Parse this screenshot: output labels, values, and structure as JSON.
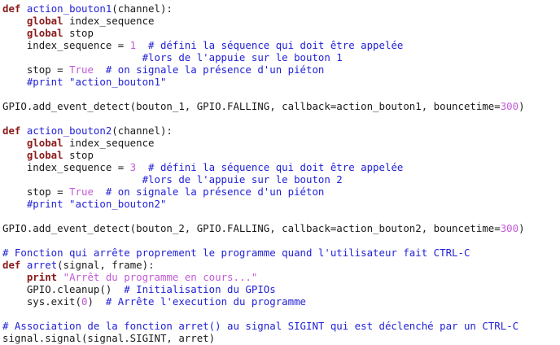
{
  "editor": {
    "theme": {
      "keyword": "#8b1a1a",
      "function_name": "#1f1fd6",
      "number": "#c25bd6",
      "string": "#c25bd6",
      "comment": "#1f1fd6",
      "text": "#1a1a1a",
      "background": "#ffffff"
    },
    "lines": [
      [
        {
          "t": "def",
          "c": "kw"
        },
        {
          "t": " ",
          "c": "pl"
        },
        {
          "t": "action_bouton1",
          "c": "fn"
        },
        {
          "t": "(channel):",
          "c": "pl"
        }
      ],
      [
        {
          "t": "    ",
          "c": "pl"
        },
        {
          "t": "global",
          "c": "kw"
        },
        {
          "t": " index_sequence",
          "c": "pl"
        }
      ],
      [
        {
          "t": "    ",
          "c": "pl"
        },
        {
          "t": "global",
          "c": "kw"
        },
        {
          "t": " stop",
          "c": "pl"
        }
      ],
      [
        {
          "t": "    index_sequence = ",
          "c": "pl"
        },
        {
          "t": "1",
          "c": "num"
        },
        {
          "t": "  ",
          "c": "pl"
        },
        {
          "t": "# défini la séquence qui doit être appelée",
          "c": "com"
        }
      ],
      [
        {
          "t": "                       ",
          "c": "pl"
        },
        {
          "t": "#lors de l'appuie sur le bouton 1",
          "c": "com"
        }
      ],
      [
        {
          "t": "    stop = ",
          "c": "pl"
        },
        {
          "t": "True",
          "c": "num"
        },
        {
          "t": "  ",
          "c": "pl"
        },
        {
          "t": "# on signale la présence d'un piéton",
          "c": "com"
        }
      ],
      [
        {
          "t": "    ",
          "c": "pl"
        },
        {
          "t": "#print \"action_bouton1\"",
          "c": "com"
        }
      ],
      [
        {
          "t": "",
          "c": "pl"
        }
      ],
      [
        {
          "t": "GPIO.add_event_detect(bouton_1, GPIO.FALLING, callback=action_bouton1, bouncetime=",
          "c": "pl"
        },
        {
          "t": "300",
          "c": "num"
        },
        {
          "t": ")",
          "c": "pl"
        }
      ],
      [
        {
          "t": "",
          "c": "pl"
        }
      ],
      [
        {
          "t": "def",
          "c": "kw"
        },
        {
          "t": " ",
          "c": "pl"
        },
        {
          "t": "action_bouton2",
          "c": "fn"
        },
        {
          "t": "(channel):",
          "c": "pl"
        }
      ],
      [
        {
          "t": "    ",
          "c": "pl"
        },
        {
          "t": "global",
          "c": "kw"
        },
        {
          "t": " index_sequence",
          "c": "pl"
        }
      ],
      [
        {
          "t": "    ",
          "c": "pl"
        },
        {
          "t": "global",
          "c": "kw"
        },
        {
          "t": " stop",
          "c": "pl"
        }
      ],
      [
        {
          "t": "    index_sequence = ",
          "c": "pl"
        },
        {
          "t": "3",
          "c": "num"
        },
        {
          "t": "  ",
          "c": "pl"
        },
        {
          "t": "# défini la séquence qui doit être appelée",
          "c": "com"
        }
      ],
      [
        {
          "t": "                       ",
          "c": "pl"
        },
        {
          "t": "#lors de l'appuie sur le bouton 2",
          "c": "com"
        }
      ],
      [
        {
          "t": "    stop = ",
          "c": "pl"
        },
        {
          "t": "True",
          "c": "num"
        },
        {
          "t": "  ",
          "c": "pl"
        },
        {
          "t": "# on signale la présence d'un piéton",
          "c": "com"
        }
      ],
      [
        {
          "t": "    ",
          "c": "pl"
        },
        {
          "t": "#print \"action_bouton2\"",
          "c": "com"
        }
      ],
      [
        {
          "t": "",
          "c": "pl"
        }
      ],
      [
        {
          "t": "GPIO.add_event_detect(bouton_2, GPIO.FALLING, callback=action_bouton2, bouncetime=",
          "c": "pl"
        },
        {
          "t": "300",
          "c": "num"
        },
        {
          "t": ")",
          "c": "pl"
        }
      ],
      [
        {
          "t": "",
          "c": "pl"
        }
      ],
      [
        {
          "t": "# Fonction qui arrête proprement le programme quand l'utilisateur fait CTRL-C",
          "c": "com"
        }
      ],
      [
        {
          "t": "def",
          "c": "kw"
        },
        {
          "t": " ",
          "c": "pl"
        },
        {
          "t": "arret",
          "c": "fn"
        },
        {
          "t": "(signal, frame):",
          "c": "pl"
        }
      ],
      [
        {
          "t": "    ",
          "c": "pl"
        },
        {
          "t": "print",
          "c": "kw"
        },
        {
          "t": " ",
          "c": "pl"
        },
        {
          "t": "\"Arrêt du programme en cours...\"",
          "c": "str"
        }
      ],
      [
        {
          "t": "    GPIO.cleanup()  ",
          "c": "pl"
        },
        {
          "t": "# Initialisation du GPIOs",
          "c": "com"
        }
      ],
      [
        {
          "t": "    sys.exit(",
          "c": "pl"
        },
        {
          "t": "0",
          "c": "num"
        },
        {
          "t": ")  ",
          "c": "pl"
        },
        {
          "t": "# Arrête l'execution du programme",
          "c": "com"
        }
      ],
      [
        {
          "t": "",
          "c": "pl"
        }
      ],
      [
        {
          "t": "# Association de la fonction arret() au signal SIGINT qui est déclenché par un CTRL-C",
          "c": "com"
        }
      ],
      [
        {
          "t": "signal.signal(signal.SIGINT, arret)",
          "c": "pl"
        }
      ]
    ]
  }
}
